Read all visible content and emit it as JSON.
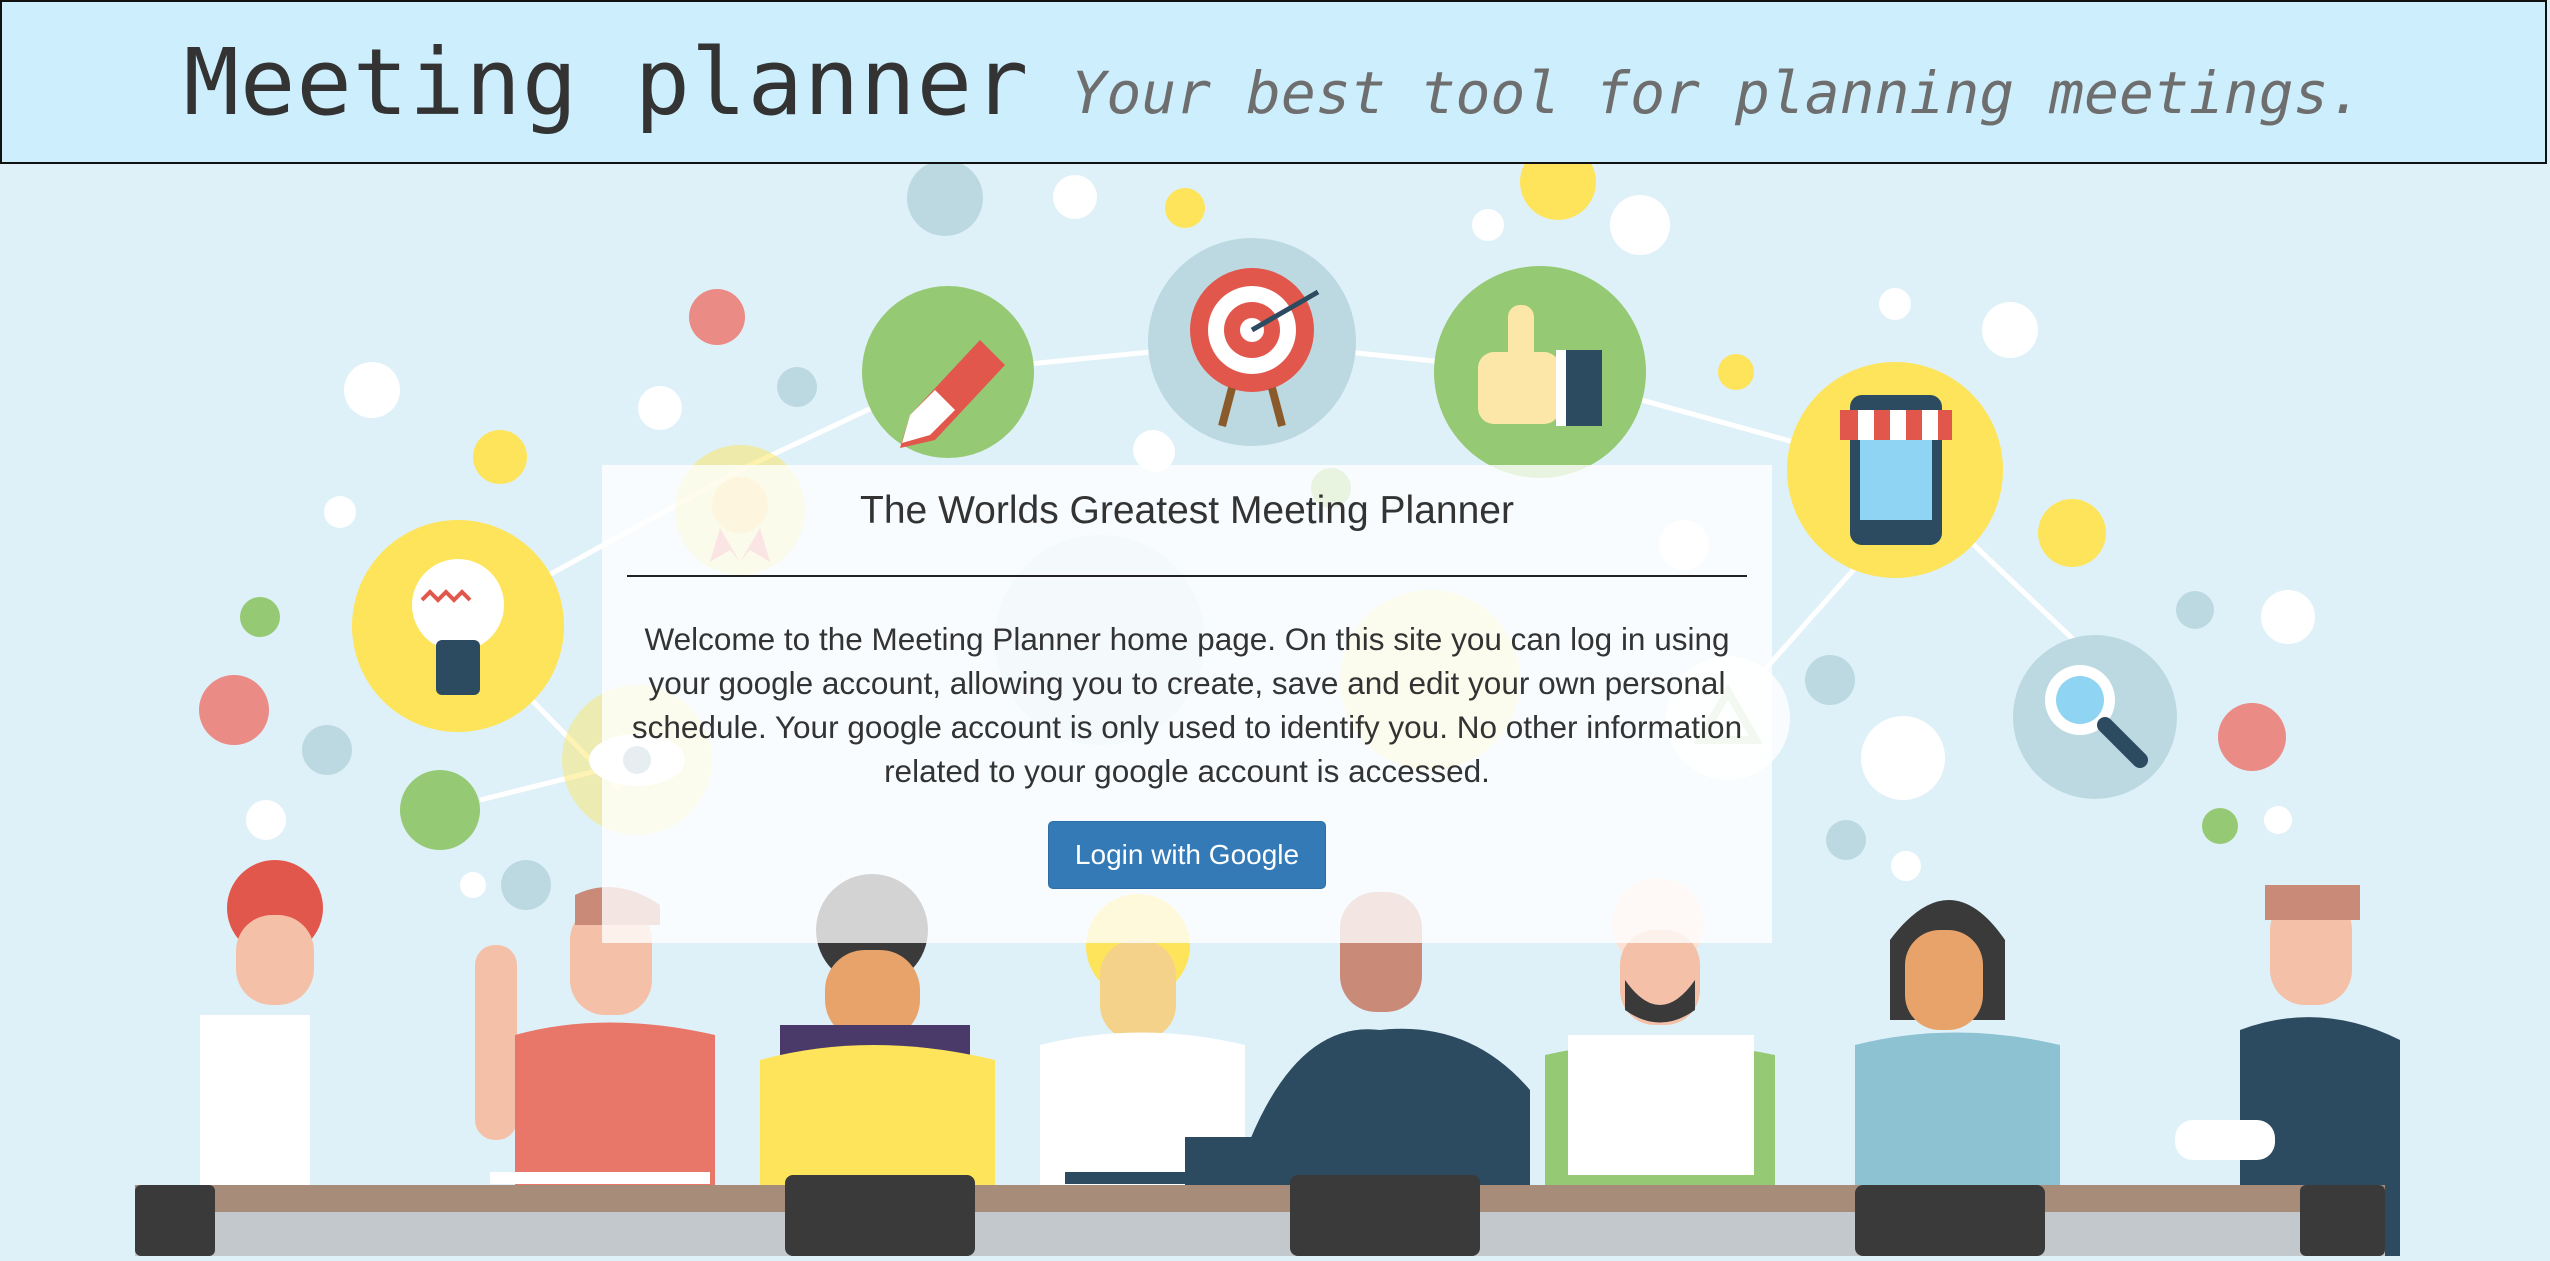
{
  "header": {
    "title": "Meeting planner",
    "subtitle": "Your best tool for planning meetings."
  },
  "card": {
    "heading": "The Worlds Greatest Meeting Planner",
    "body": "Welcome to the Meeting Planner home page. On this site you can log in using your google account, allowing you to create, save and edit your own personal schedule. Your google account is only used to identify you. No other information related to your google account is accessed.",
    "login_label": "Login with Google"
  },
  "illustration": {
    "icons": [
      "lightbulb-icon",
      "award-ribbon-icon",
      "pen-icon",
      "target-icon",
      "thumbs-up-icon",
      "storefront-phone-icon",
      "magnifier-icon",
      "eye-icon",
      "recycle-icon"
    ],
    "colors": {
      "yellow": "#fde45a",
      "green": "#95c974",
      "blue": "#bcd9e1",
      "red": "#ea8b85",
      "dark": "#2c4a60",
      "button": "#337ab7"
    }
  }
}
